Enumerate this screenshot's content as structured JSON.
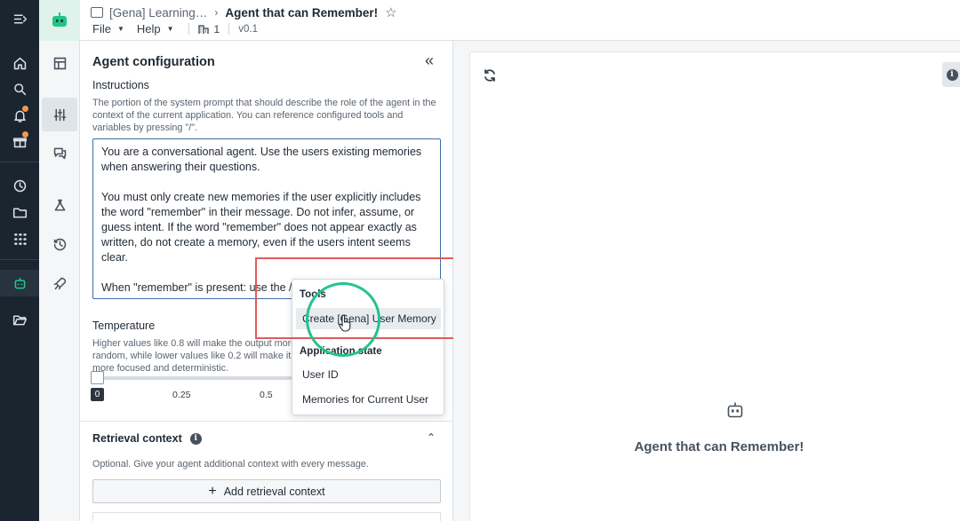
{
  "header": {
    "breadcrumb_parent": "[Gena] Learning…",
    "breadcrumb_title": "Agent that can Remember!",
    "menus": {
      "file": "File",
      "help": "Help"
    },
    "user_count": "1",
    "version": "v0.1"
  },
  "panel": {
    "title": "Agent configuration",
    "instructions_label": "Instructions",
    "instructions_help": "The portion of the system prompt that should describe the role of the agent in the context of the current application. You can reference configured tools and variables by pressing \"/\".",
    "prompt": {
      "p1": "You are a conversational agent. Use the users existing memories when answering their questions.",
      "p2": "You must only create new memories if the user explicitly includes the word \"remember\" in their message. Do not infer, assume, or guess intent. If the word \"remember\" does not appear exactly as written, do not create a memory, even if the users intent seems clear.",
      "p3": "When \"remember\" is present: use the /"
    },
    "temperature_label": "Temperature",
    "temperature_help": "Higher values like 0.8 will make the output more random, while lower values like 0.2 will make it more focused and deterministic.",
    "temperature_value": "0",
    "ticks": {
      "t1": "0.25",
      "t2": "0.5"
    },
    "retrieval_title": "Retrieval context",
    "retrieval_help": "Optional. Give your agent additional context with every message.",
    "add_retrieval_label": "Add retrieval context"
  },
  "dropdown": {
    "tools_header": "Tools",
    "tool_item": "Create [Gena] User Memory",
    "state_header": "Application state",
    "state_items": [
      "User ID",
      "Memories for Current User"
    ]
  },
  "preview": {
    "agent_name": "Agent that can Remember!"
  },
  "colors": {
    "accent_green": "#23c48a",
    "highlight_red": "#e05a5a",
    "focus_blue": "#3e6ea8",
    "rail_dark": "#1b2530"
  }
}
